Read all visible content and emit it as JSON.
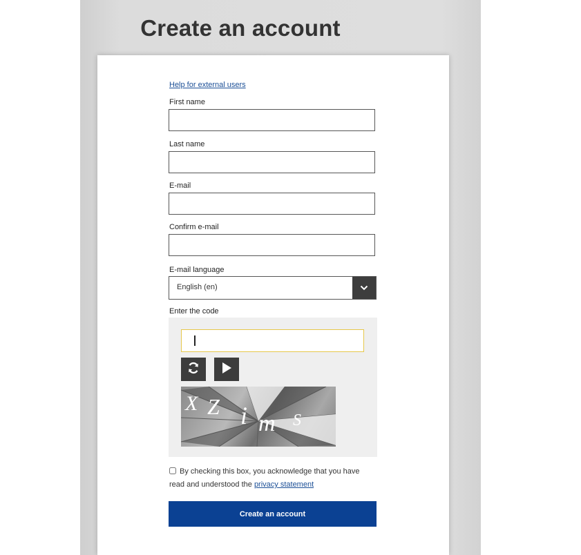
{
  "page": {
    "title": "Create an account"
  },
  "form": {
    "help_link": "Help for external users",
    "first_name": {
      "label": "First name",
      "value": ""
    },
    "last_name": {
      "label": "Last name",
      "value": ""
    },
    "email": {
      "label": "E-mail",
      "value": ""
    },
    "confirm_email": {
      "label": "Confirm e-mail",
      "value": ""
    },
    "email_language": {
      "label": "E-mail language",
      "selected": "English (en)"
    },
    "captcha": {
      "label": "Enter the code",
      "value": "",
      "refresh_icon": "refresh-icon",
      "play_icon": "play-icon",
      "image_text": "XZimS"
    },
    "consent": {
      "text": "By checking this box, you acknowledge that you have read and understood the ",
      "link": "privacy statement",
      "checked": false
    },
    "submit_label": "Create an account"
  },
  "colors": {
    "primary_button": "#0b4193",
    "link": "#1a4e96",
    "captcha_focus_border": "#e6c74a"
  }
}
